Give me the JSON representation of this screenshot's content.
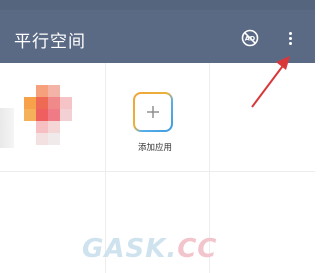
{
  "appbar": {
    "title": "平行空间",
    "color": "#5b6a84",
    "icons": {
      "ads": "no-ads-icon",
      "more": "more-vert-icon"
    }
  },
  "apps": {
    "blurred_app": {
      "label": ""
    },
    "add_app": {
      "label": "添加应用",
      "icon": "plus-icon"
    }
  },
  "annotation": {
    "arrow_color": "#d9373a"
  },
  "watermark": {
    "text_a": "GASK.",
    "text_b": "CC"
  }
}
